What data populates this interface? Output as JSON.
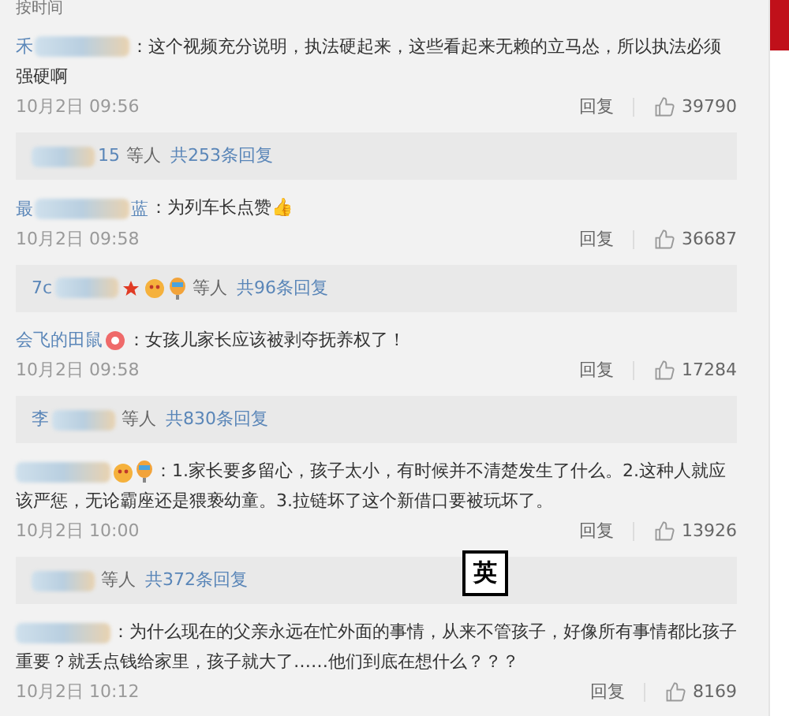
{
  "header": {
    "sort_label": "按时间"
  },
  "comments": [
    {
      "name_parts": [
        {
          "kind": "text",
          "text": "禾"
        },
        {
          "kind": "blur"
        }
      ],
      "body": "：这个视频充分说明，执法硬起来，这些看起来无赖的立马怂，所以执法必须强硬啊",
      "date": "10月2日 09:56",
      "reply_label": "回复",
      "likes": "39790",
      "replies": {
        "parts": [
          {
            "kind": "blur"
          },
          {
            "kind": "text",
            "text": "15"
          }
        ],
        "suffix": "等人",
        "link": "共253条回复"
      }
    },
    {
      "name_parts": [
        {
          "kind": "text",
          "text": "最"
        },
        {
          "kind": "blur"
        },
        {
          "kind": "text",
          "text": "蓝"
        }
      ],
      "body": "：为列车长点赞👍",
      "date": "10月2日 09:58",
      "reply_label": "回复",
      "likes": "36687",
      "replies": {
        "parts": [
          {
            "kind": "text",
            "text": "7c"
          },
          {
            "kind": "blur"
          },
          {
            "kind": "star"
          },
          {
            "kind": "face"
          },
          {
            "kind": "balloon"
          }
        ],
        "suffix": "等人",
        "link": "共96条回复"
      }
    },
    {
      "name_parts": [
        {
          "kind": "text",
          "text": "会飞的田鼠"
        },
        {
          "kind": "ring"
        }
      ],
      "body": "：女孩儿家长应该被剥夺抚养权了！",
      "date": "10月2日 09:58",
      "reply_label": "回复",
      "likes": "17284",
      "replies": {
        "parts": [
          {
            "kind": "text",
            "text": "李"
          },
          {
            "kind": "blur"
          }
        ],
        "suffix": "等人",
        "link": "共830条回复"
      }
    },
    {
      "name_parts": [
        {
          "kind": "blur"
        },
        {
          "kind": "face"
        },
        {
          "kind": "balloon"
        }
      ],
      "body": "：1.家长要多留心，孩子太小，有时候并不清楚发生了什么。2.这种人就应该严惩，无论霸座还是猥亵幼童。3.拉链坏了这个新借口要被玩坏了。",
      "date": "10月2日 10:00",
      "reply_label": "回复",
      "likes": "13926",
      "replies": {
        "parts": [
          {
            "kind": "blur"
          }
        ],
        "suffix": "等人",
        "link": "共372条回复"
      }
    },
    {
      "name_parts": [
        {
          "kind": "blur"
        }
      ],
      "body": "：为什么现在的父亲永远在忙外面的事情，从来不管孩子，好像所有事情都比孩子重要？就丢点钱给家里，孩子就大了……他们到底在想什么？？？",
      "date": "10月2日 10:12",
      "reply_label": "回复",
      "likes": "8169"
    }
  ],
  "ime_indicator": "英"
}
